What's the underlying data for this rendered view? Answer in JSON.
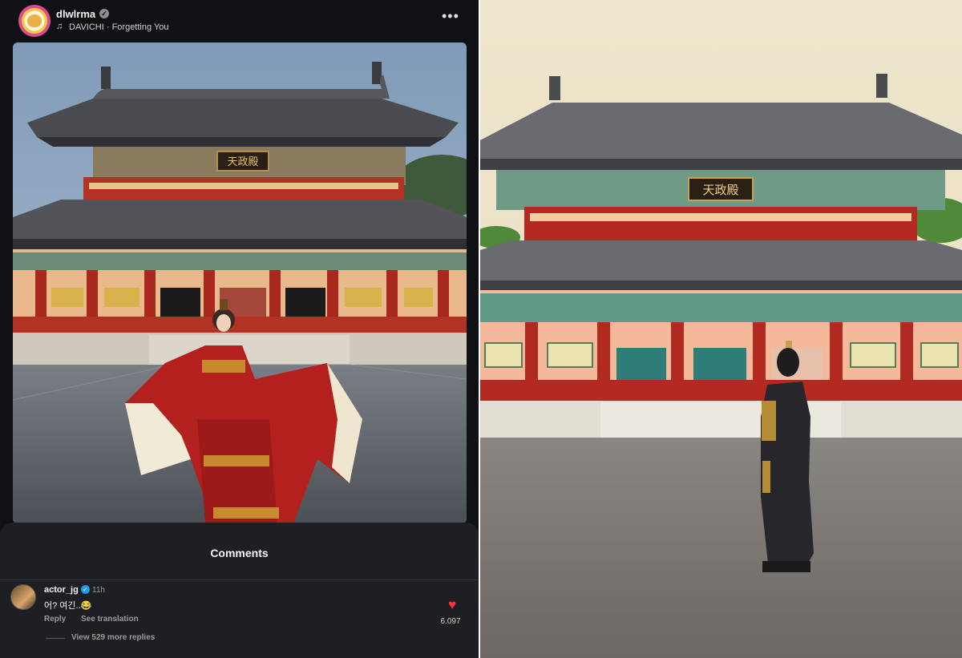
{
  "post": {
    "username": "dlwlrma",
    "verified_glyph": "✓",
    "song": "DAVICHI · Forgetting You",
    "music_icon": "♫",
    "more_icon": "•••"
  },
  "comments": {
    "title": "Comments",
    "items": [
      {
        "username": "actor_jg",
        "verified_glyph": "✓",
        "time": "11h",
        "text": "어? 여긴..😂",
        "reply_label": "Reply",
        "translate_label": "See translation",
        "likes": "6.097",
        "heart_icon": "♥",
        "view_replies": "View 529 more replies"
      }
    ]
  },
  "photos": {
    "left": {
      "plaque": "天政殿",
      "subject": "woman-in-red-hanbok"
    },
    "right": {
      "plaque": "天政殿",
      "subject": "man-in-black-robe"
    }
  },
  "colors": {
    "app_bg": "#0f1114",
    "sheet_bg": "#1d1f23",
    "like_red": "#ff3040",
    "verified_blue": "#1d9bf0"
  }
}
